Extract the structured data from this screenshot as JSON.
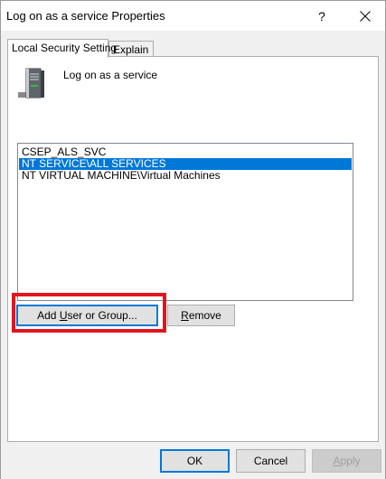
{
  "window": {
    "title": "Log on as a service Properties",
    "help_label": "?"
  },
  "tabs": [
    {
      "label": "Local Security Setting",
      "active": true
    },
    {
      "label": "Explain",
      "active": false
    }
  ],
  "policy": {
    "name": "Log on as a service",
    "icon": "server-icon"
  },
  "accounts": {
    "items": [
      {
        "label": "CSEP_ALS_SVC",
        "selected": false
      },
      {
        "label": "NT SERVICE\\ALL SERVICES",
        "selected": true
      },
      {
        "label": "NT VIRTUAL MACHINE\\Virtual Machines",
        "selected": false
      }
    ]
  },
  "actions": {
    "add_prefix": "Add ",
    "add_mnemonic": "U",
    "add_suffix": "ser or Group...",
    "remove_mnemonic": "R",
    "remove_suffix": "emove"
  },
  "footer": {
    "ok_label": "OK",
    "cancel_label": "Cancel",
    "apply_mnemonic": "A",
    "apply_suffix": "pply"
  },
  "colors": {
    "selection": "#0078d7",
    "highlight": "#e0161e"
  }
}
